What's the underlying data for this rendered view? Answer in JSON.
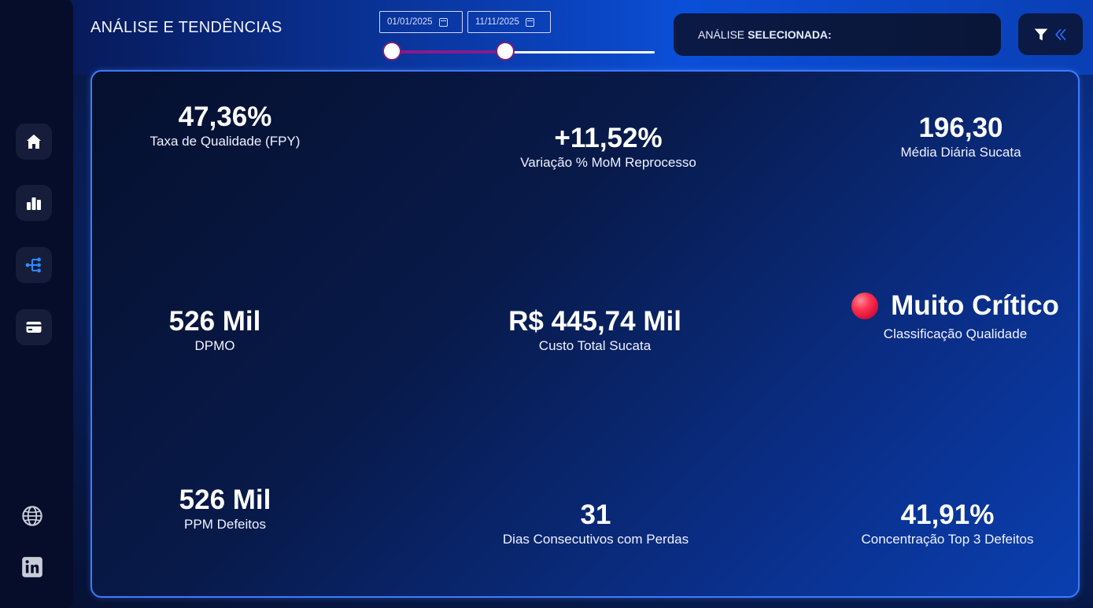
{
  "header": {
    "title": "ANÁLISE E TENDÊNCIAS",
    "date_start": "01/01/2025",
    "date_end": "11/11/2025",
    "analysis_prefix": "ANÁLISE",
    "analysis_bold": "SELECIONADA:",
    "slider_range": {
      "start_fraction": 0.0,
      "end_fraction": 0.43
    }
  },
  "sidebar": {
    "items": [
      {
        "name": "home",
        "icon": "home-icon",
        "active": false
      },
      {
        "name": "charts",
        "icon": "bar-chart-icon",
        "active": false
      },
      {
        "name": "tree",
        "icon": "hierarchy-icon",
        "active": true
      },
      {
        "name": "card",
        "icon": "card-icon",
        "active": false
      }
    ],
    "bottom": [
      {
        "name": "globe",
        "icon": "globe-icon"
      },
      {
        "name": "linkedin",
        "icon": "linkedin-icon"
      }
    ]
  },
  "kpis": {
    "fpy": {
      "value": "47,36%",
      "label": "Taxa de Qualidade (FPY)"
    },
    "mom": {
      "value": "+11,52%",
      "label": "Variação % MoM Reprocesso"
    },
    "scrap_daily": {
      "value": "196,30",
      "label": "Média Diária Sucata"
    },
    "dpmo": {
      "value": "526 Mil",
      "label": "DPMO"
    },
    "scrap_cost": {
      "value": "R$ 445,74 Mil",
      "label": "Custo Total Sucata"
    },
    "classification": {
      "value": "Muito Crítico",
      "label": "Classificação Qualidade",
      "status_color": "#ff2e4a"
    },
    "ppm": {
      "value": "526 Mil",
      "label": "PPM Defeitos"
    },
    "days": {
      "value": "31",
      "label": "Dias Consecutivos com Perdas"
    },
    "top3": {
      "value": "41,91%",
      "label": "Concentração Top 3 Defeitos"
    }
  },
  "colors": {
    "accent": "#3d7bff",
    "filter_arrow": "#2f6bff"
  }
}
